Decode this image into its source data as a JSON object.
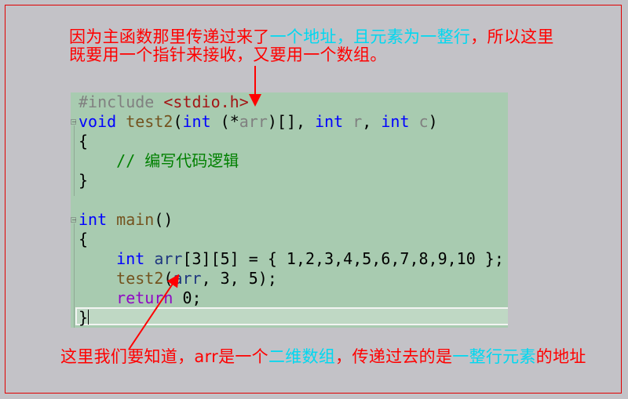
{
  "annotations": {
    "top_line1": [
      {
        "text": "因为主函数那里传递过来了",
        "color": "#ff0000"
      },
      {
        "text": "一个地址，且元素为一整行",
        "color": "#00d8f0"
      },
      {
        "text": "，所以这里",
        "color": "#ff0000"
      }
    ],
    "top_line2": "既要用一个指针来接收，又要用一个数组。",
    "bottom": [
      {
        "text": "这里我们要知道，arr是一个",
        "color": "#ff0000"
      },
      {
        "text": "二维数组",
        "color": "#00d8f0"
      },
      {
        "text": "，传递过去的是",
        "color": "#ff0000"
      },
      {
        "text": "一整行元素",
        "color": "#00d8f0"
      },
      {
        "text": "的地址",
        "color": "#ff0000"
      }
    ]
  },
  "code_lines": [
    [
      {
        "t": "#include ",
        "c": "#808080"
      },
      {
        "t": "<stdio.h>",
        "c": "#a31515"
      }
    ],
    [
      {
        "t": "void",
        "c": "#0000ff"
      },
      {
        "t": " "
      },
      {
        "t": "test2",
        "c": "#74531f"
      },
      {
        "t": "("
      },
      {
        "t": "int",
        "c": "#0000ff"
      },
      {
        "t": " (*"
      },
      {
        "t": "arr",
        "c": "#808080"
      },
      {
        "t": ")[], "
      },
      {
        "t": "int",
        "c": "#0000ff"
      },
      {
        "t": " "
      },
      {
        "t": "r",
        "c": "#808080"
      },
      {
        "t": ", "
      },
      {
        "t": "int",
        "c": "#0000ff"
      },
      {
        "t": " "
      },
      {
        "t": "c",
        "c": "#808080"
      },
      {
        "t": ")"
      }
    ],
    [
      {
        "t": "{"
      }
    ],
    [
      {
        "t": "    // 编写代码逻辑",
        "c": "#008000"
      }
    ],
    [
      {
        "t": "}"
      }
    ],
    [
      {
        "t": ""
      }
    ],
    [
      {
        "t": "int",
        "c": "#0000ff"
      },
      {
        "t": " "
      },
      {
        "t": "main",
        "c": "#74531f"
      },
      {
        "t": "()"
      }
    ],
    [
      {
        "t": "{"
      }
    ],
    [
      {
        "t": "    "
      },
      {
        "t": "int",
        "c": "#0000ff"
      },
      {
        "t": " "
      },
      {
        "t": "arr",
        "c": "#1f377f"
      },
      {
        "t": "[3][5] = { 1,2,3,4,5,6,7,8,9,10 };"
      }
    ],
    [
      {
        "t": "    "
      },
      {
        "t": "test2",
        "c": "#74531f"
      },
      {
        "t": "("
      },
      {
        "t": "arr",
        "c": "#1f377f"
      },
      {
        "t": ", 3, 5);"
      }
    ],
    [
      {
        "t": "    "
      },
      {
        "t": "return",
        "c": "#8f08c4"
      },
      {
        "t": " 0;"
      }
    ],
    [
      {
        "t": "}"
      }
    ]
  ],
  "colors": {
    "accent_red": "#ff0000",
    "accent_cyan": "#00d8f0",
    "editor_bg": "#a8cbb0"
  }
}
